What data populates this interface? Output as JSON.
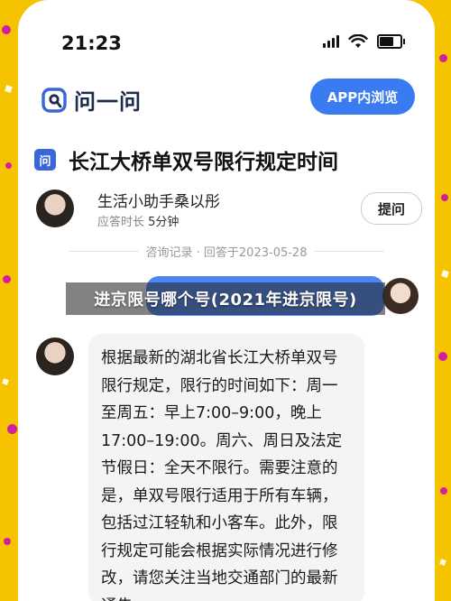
{
  "status_bar": {
    "time": "21:23"
  },
  "app_header": {
    "logo_text": "问一问",
    "open_in_app_label": "APP内浏览"
  },
  "question": {
    "badge": "问",
    "title": "长江大桥单双号限行规定时间"
  },
  "answerer": {
    "name": "生活小助手桑以彤",
    "duration_label": "应答时长",
    "duration_value": "5分钟",
    "ask_button_label": "提问"
  },
  "meta": {
    "text": "咨询记录 · 回答于2023-05-28"
  },
  "banner": {
    "text": "进京限号哪个号(2021年进京限号)"
  },
  "answer": {
    "text": "根据最新的湖北省长江大桥单双号限行规定，限行的时间如下：周一至周五：早上7:00–9:00，晚上17:00–19:00。周六、周日及法定节假日：全天不限行。需要注意的是，单双号限行适用于所有车辆，包括过江轻轨和小客车。此外，限行规定可能会根据实际情况进行修改，请您关注当地交通部门的最新通告。"
  },
  "colors": {
    "background_yellow": "#f6c300",
    "confetti_magenta": "#d01fa0",
    "accent_blue": "#3a7bf2",
    "question_bubble_blue": "#4a86f5"
  },
  "icons": [
    "signal-icon",
    "wifi-icon",
    "battery-icon",
    "logo-icon"
  ]
}
